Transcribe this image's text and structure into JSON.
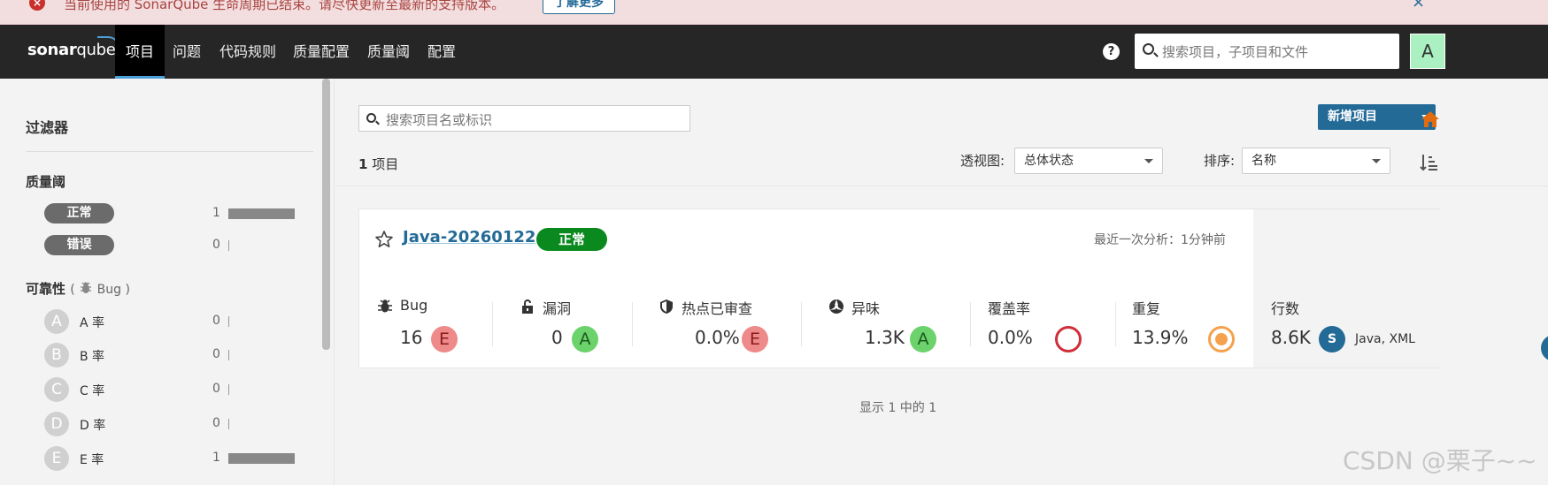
{
  "banner": {
    "message": "当前使用的 SonarQube 生命周期已结束。请尽快更新至最新的支持版本。",
    "learn_more": "了解更多",
    "close": "×"
  },
  "navbar": {
    "logo_sonar": "sonar",
    "logo_qube": "qube",
    "items": [
      "项目",
      "问题",
      "代码规则",
      "质量配置",
      "质量阈",
      "配置"
    ],
    "active_index": 0,
    "help": "?",
    "search_placeholder": "搜索项目，子项目和文件",
    "avatar": "A"
  },
  "sidebar": {
    "filters_title": "过滤器",
    "quality_gate": {
      "title": "质量阈",
      "options": [
        {
          "label": "正常",
          "count": "1",
          "fraction": 1.0
        },
        {
          "label": "错误",
          "count": "0",
          "fraction": 0.0
        }
      ]
    },
    "reliability": {
      "title": "可靠性",
      "subtitle": "Bug",
      "paren_open": "(",
      "paren_close": ")",
      "grades": [
        {
          "letter": "A",
          "label": "A 率",
          "count": "0",
          "fraction": 0.0
        },
        {
          "letter": "B",
          "label": "B 率",
          "count": "0",
          "fraction": 0.0
        },
        {
          "letter": "C",
          "label": "C 率",
          "count": "0",
          "fraction": 0.0
        },
        {
          "letter": "D",
          "label": "D 率",
          "count": "0",
          "fraction": 0.0
        },
        {
          "letter": "E",
          "label": "E 率",
          "count": "1",
          "fraction": 1.0
        }
      ]
    }
  },
  "main": {
    "search_placeholder": "搜索项目名或标识",
    "new_project": "新增项目",
    "project_count": "1",
    "project_count_label": "项目",
    "perspective_label": "透视图:",
    "perspective_value": "总体状态",
    "sort_label": "排序:",
    "sort_value": "名称",
    "showing": "显示 1 中的 1"
  },
  "project": {
    "name": "Java-20260122",
    "status": "正常",
    "last_analysis": "最近一次分析：1分钟前",
    "metrics": {
      "bug": {
        "label": "Bug",
        "value": "16",
        "rating": "E"
      },
      "vuln": {
        "label": "漏洞",
        "value": "0",
        "rating": "A"
      },
      "hotspots": {
        "label": "热点已审查",
        "value": "0.0%",
        "rating": "E"
      },
      "smells": {
        "label": "异味",
        "value": "1.3K",
        "rating": "A"
      },
      "coverage": {
        "label": "覆盖率",
        "value": "0.0%"
      },
      "dup": {
        "label": "重复",
        "value": "13.9%"
      },
      "lines": {
        "label": "行数",
        "value": "8.6K",
        "size": "S",
        "languages": "Java, XML"
      }
    }
  },
  "watermark": "CSDN @栗子~~",
  "colors": {
    "nav_bg": "#262626",
    "accent": "#236a97",
    "ok_green": "#0a8a1e",
    "rating_e": "#ee8a8a",
    "rating_a": "#6cd26c",
    "coverage_ring": "#d02f3a",
    "dup_ring": "#f4a24d",
    "home_icon": "#e06b10"
  },
  "icons": {
    "banner": "error-circle-icon",
    "help": "help-icon",
    "search": "search-icon",
    "star": "star-icon",
    "bug": "bug-icon",
    "vuln": "lock-icon",
    "hotspot": "shield-icon",
    "smell": "code-smell-icon",
    "home": "home-icon",
    "sort": "sort-icon"
  }
}
